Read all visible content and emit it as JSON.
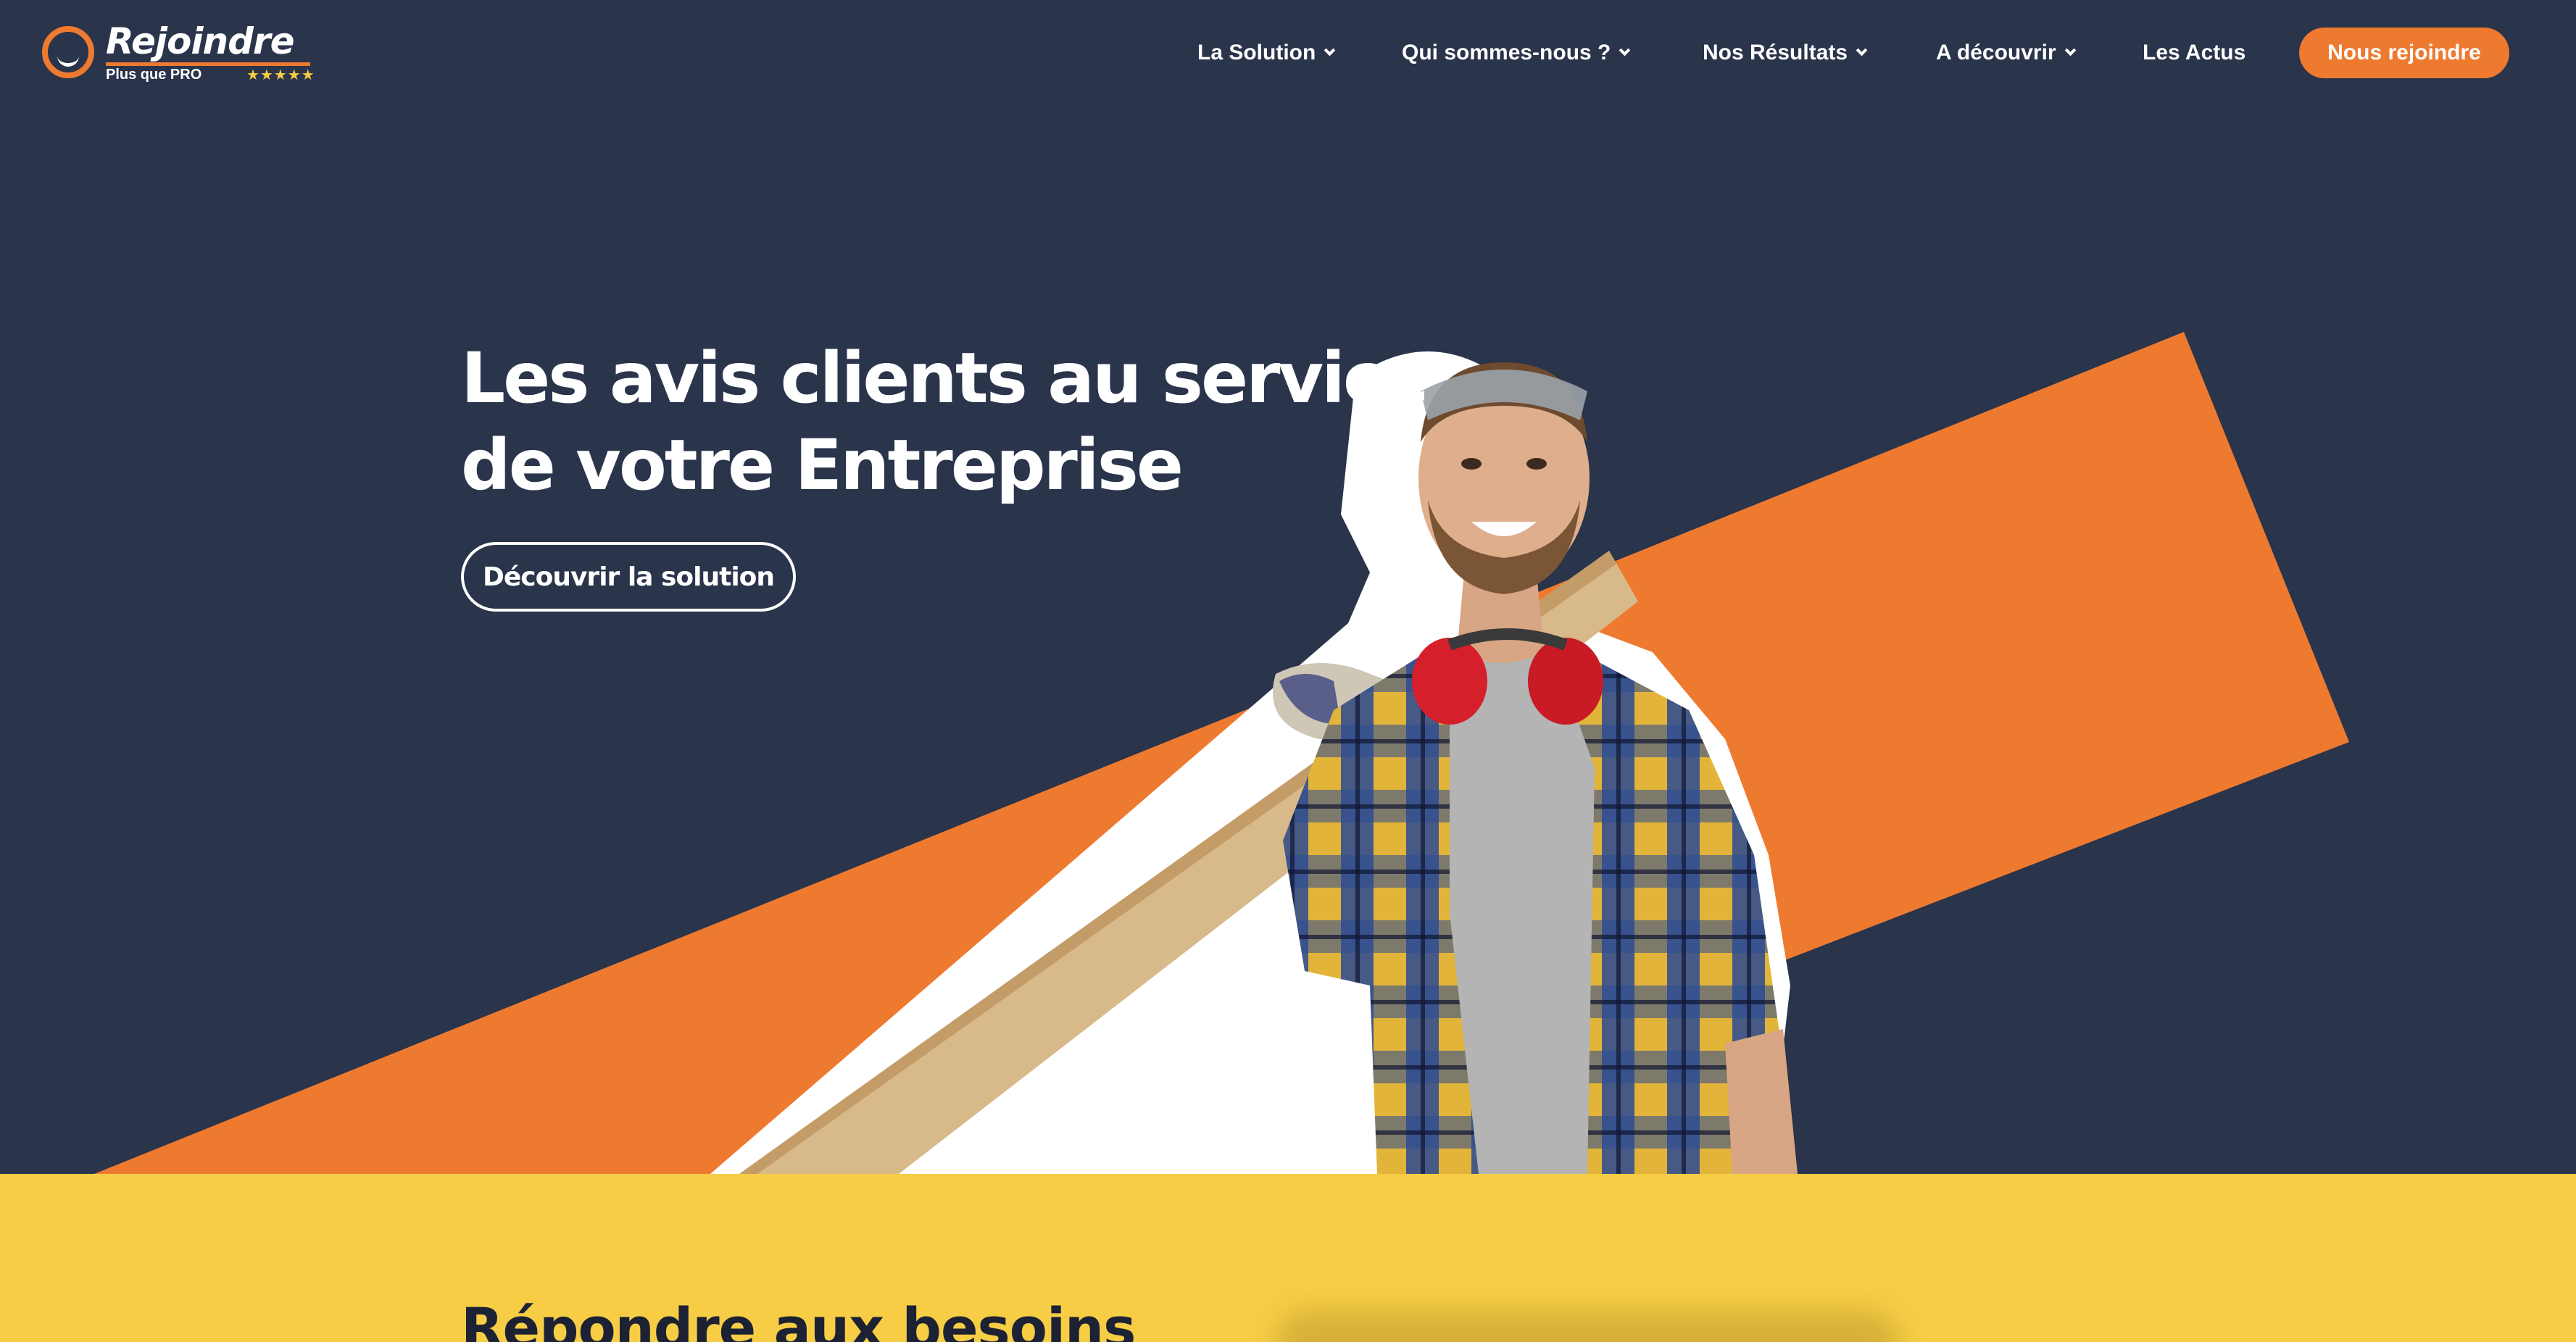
{
  "brand": {
    "name": "Rejoindre",
    "tagline": "Plus que PRO",
    "stars": "★★★★★",
    "accent_color": "#ee7a30",
    "background_color": "#2a344b",
    "yellow_color": "#f6cd45"
  },
  "nav": {
    "items": [
      {
        "label": "La Solution",
        "has_dropdown": true
      },
      {
        "label": "Qui sommes-nous ?",
        "has_dropdown": true
      },
      {
        "label": "Nos Résultats",
        "has_dropdown": true
      },
      {
        "label": "A découvrir",
        "has_dropdown": true
      },
      {
        "label": "Les Actus",
        "has_dropdown": false
      }
    ],
    "join_label": "Nous rejoindre"
  },
  "hero": {
    "title_line1": "Les avis clients au service",
    "title_line2": "de votre Entreprise",
    "cta_label": "Découvrir la solution",
    "image": "worker-carrying-wooden-plank"
  },
  "section": {
    "title": "Répondre aux besoins"
  }
}
